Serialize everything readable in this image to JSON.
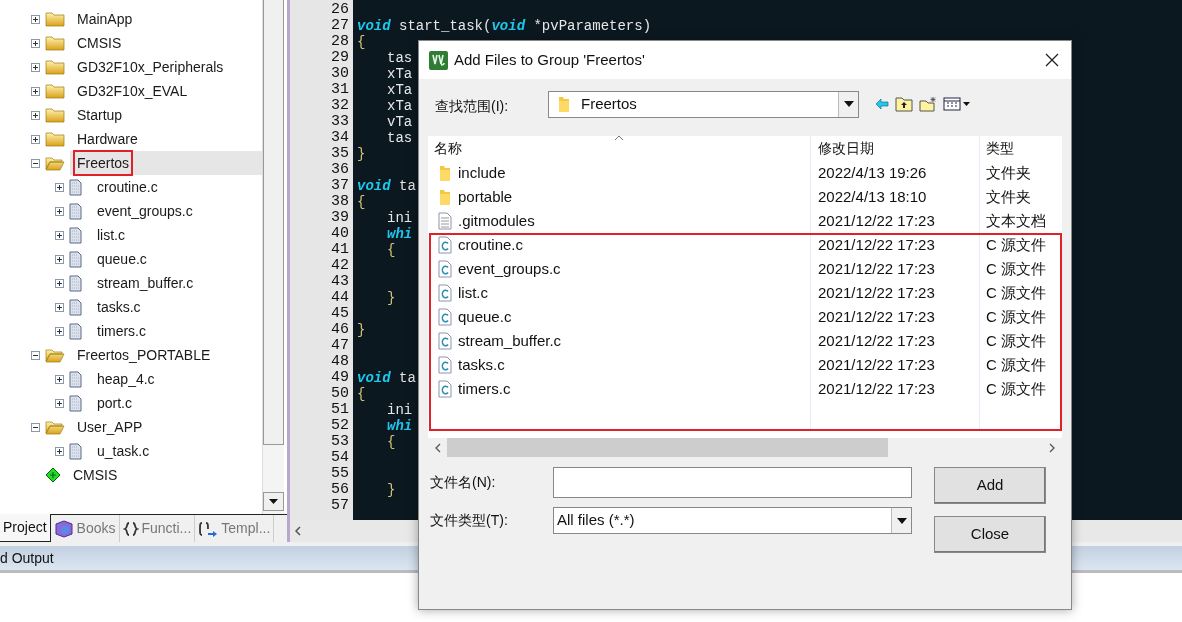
{
  "project_tree": [
    {
      "label": "MainApp",
      "kind": "group",
      "expanded": false,
      "selected": false,
      "highlighted": false
    },
    {
      "label": "CMSIS",
      "kind": "group",
      "expanded": false,
      "selected": false,
      "highlighted": false
    },
    {
      "label": "GD32F10x_Peripherals",
      "kind": "group",
      "expanded": false,
      "selected": false,
      "highlighted": false
    },
    {
      "label": "GD32F10x_EVAL",
      "kind": "group",
      "expanded": false,
      "selected": false,
      "highlighted": false
    },
    {
      "label": "Startup",
      "kind": "group",
      "expanded": false,
      "selected": false,
      "highlighted": false
    },
    {
      "label": "Hardware",
      "kind": "group",
      "expanded": false,
      "selected": false,
      "highlighted": false
    },
    {
      "label": "Freertos",
      "kind": "group",
      "expanded": true,
      "selected": true,
      "highlighted": true,
      "children": [
        {
          "label": "croutine.c",
          "kind": "file"
        },
        {
          "label": "event_groups.c",
          "kind": "file"
        },
        {
          "label": "list.c",
          "kind": "file"
        },
        {
          "label": "queue.c",
          "kind": "file"
        },
        {
          "label": "stream_buffer.c",
          "kind": "file"
        },
        {
          "label": "tasks.c",
          "kind": "file"
        },
        {
          "label": "timers.c",
          "kind": "file"
        }
      ]
    },
    {
      "label": "Freertos_PORTABLE",
      "kind": "group",
      "expanded": true,
      "selected": false,
      "highlighted": false,
      "children": [
        {
          "label": "heap_4.c",
          "kind": "file"
        },
        {
          "label": "port.c",
          "kind": "file"
        }
      ]
    },
    {
      "label": "User_APP",
      "kind": "group",
      "expanded": true,
      "selected": false,
      "highlighted": false,
      "children": [
        {
          "label": "u_task.c",
          "kind": "file"
        }
      ]
    },
    {
      "label": "CMSIS",
      "kind": "component",
      "selected": false,
      "highlighted": false
    }
  ],
  "panel_tabs": [
    {
      "label": "Project",
      "kind": "project",
      "selected": true
    },
    {
      "label": "Books",
      "kind": "books",
      "selected": false
    },
    {
      "label": "Functi...",
      "kind": "functions",
      "selected": false
    },
    {
      "label": "Templ...",
      "kind": "templates",
      "selected": false
    }
  ],
  "code_lines": [
    {
      "number": "26"
    },
    {
      "number": "27",
      "indented": false,
      "segments": [
        {
          "text": "void",
          "kind": "keyword"
        },
        {
          "text": " start_task(",
          "kind": "plain"
        },
        {
          "text": "void",
          "kind": "keyword"
        },
        {
          "text": " *pvParameters)",
          "kind": "plain"
        }
      ]
    },
    {
      "number": "28",
      "indented": false,
      "segments": [
        {
          "text": "{",
          "kind": "brace"
        }
      ]
    },
    {
      "number": "29",
      "indented": true,
      "segments": [
        {
          "text": "tas",
          "kind": "plain"
        }
      ]
    },
    {
      "number": "30",
      "indented": true,
      "segments": [
        {
          "text": "xTa",
          "kind": "plain"
        }
      ]
    },
    {
      "number": "31",
      "indented": true,
      "segments": [
        {
          "text": "xTa",
          "kind": "plain"
        }
      ]
    },
    {
      "number": "32",
      "indented": true,
      "segments": [
        {
          "text": "xTa",
          "kind": "plain"
        }
      ]
    },
    {
      "number": "33",
      "indented": true,
      "segments": [
        {
          "text": "vTa",
          "kind": "plain"
        }
      ]
    },
    {
      "number": "34",
      "indented": true,
      "segments": [
        {
          "text": "tas",
          "kind": "plain"
        }
      ]
    },
    {
      "number": "35",
      "indented": false,
      "segments": [
        {
          "text": "}",
          "kind": "brace"
        }
      ]
    },
    {
      "number": "36"
    },
    {
      "number": "37",
      "indented": false,
      "segments": [
        {
          "text": "void",
          "kind": "keyword"
        },
        {
          "text": " ta",
          "kind": "plain"
        }
      ]
    },
    {
      "number": "38",
      "indented": false,
      "segments": [
        {
          "text": "{",
          "kind": "brace"
        }
      ]
    },
    {
      "number": "39",
      "indented": true,
      "segments": [
        {
          "text": "ini",
          "kind": "plain"
        }
      ]
    },
    {
      "number": "40",
      "indented": true,
      "segments": [
        {
          "text": "whi",
          "kind": "keyword"
        }
      ]
    },
    {
      "number": "41",
      "indented": true,
      "segments": [
        {
          "text": "{",
          "kind": "brace"
        }
      ]
    },
    {
      "number": "42"
    },
    {
      "number": "43"
    },
    {
      "number": "44",
      "indented": true,
      "segments": [
        {
          "text": "}",
          "kind": "brace"
        }
      ]
    },
    {
      "number": "45"
    },
    {
      "number": "46",
      "indented": false,
      "segments": [
        {
          "text": "}",
          "kind": "brace"
        }
      ]
    },
    {
      "number": "47"
    },
    {
      "number": "48"
    },
    {
      "number": "49",
      "indented": false,
      "segments": [
        {
          "text": "void",
          "kind": "keyword"
        },
        {
          "text": " ta",
          "kind": "plain"
        }
      ]
    },
    {
      "number": "50",
      "indented": false,
      "segments": [
        {
          "text": "{",
          "kind": "brace"
        }
      ]
    },
    {
      "number": "51",
      "indented": true,
      "segments": [
        {
          "text": "ini",
          "kind": "plain"
        }
      ]
    },
    {
      "number": "52",
      "indented": true,
      "segments": [
        {
          "text": "whi",
          "kind": "keyword"
        }
      ]
    },
    {
      "number": "53",
      "indented": true,
      "segments": [
        {
          "text": "{",
          "kind": "brace"
        }
      ]
    },
    {
      "number": "54"
    },
    {
      "number": "55"
    },
    {
      "number": "56",
      "indented": true,
      "segments": [
        {
          "text": "}",
          "kind": "brace"
        }
      ]
    },
    {
      "number": "57"
    }
  ],
  "output_bar": {
    "title": "d Output"
  },
  "dialog": {
    "title": "Add Files to Group 'Freertos'",
    "look_in": {
      "label": "查找范围(I):",
      "value": "Freertos"
    },
    "columns": [
      "名称",
      "修改日期",
      "类型"
    ],
    "files": [
      {
        "name": "include",
        "modified": "2022/4/13 19:26",
        "type": "文件夹",
        "kind": "folder",
        "highlighted": false
      },
      {
        "name": "portable",
        "modified": "2022/4/13 18:10",
        "type": "文件夹",
        "kind": "folder",
        "highlighted": false
      },
      {
        "name": ".gitmodules",
        "modified": "2021/12/22 17:23",
        "type": "文本文档",
        "kind": "text",
        "highlighted": false
      },
      {
        "name": "croutine.c",
        "modified": "2021/12/22 17:23",
        "type": "C 源文件",
        "kind": "c",
        "highlighted": true
      },
      {
        "name": "event_groups.c",
        "modified": "2021/12/22 17:23",
        "type": "C 源文件",
        "kind": "c",
        "highlighted": true
      },
      {
        "name": "list.c",
        "modified": "2021/12/22 17:23",
        "type": "C 源文件",
        "kind": "c",
        "highlighted": true
      },
      {
        "name": "queue.c",
        "modified": "2021/12/22 17:23",
        "type": "C 源文件",
        "kind": "c",
        "highlighted": true
      },
      {
        "name": "stream_buffer.c",
        "modified": "2021/12/22 17:23",
        "type": "C 源文件",
        "kind": "c",
        "highlighted": true
      },
      {
        "name": "tasks.c",
        "modified": "2021/12/22 17:23",
        "type": "C 源文件",
        "kind": "c",
        "highlighted": true
      },
      {
        "name": "timers.c",
        "modified": "2021/12/22 17:23",
        "type": "C 源文件",
        "kind": "c",
        "highlighted": true
      }
    ],
    "file_name": {
      "label": "文件名(N):"
    },
    "file_type": {
      "label": "文件类型(T):",
      "value": "All files (*.*)"
    },
    "buttons": [
      "Add",
      "Close"
    ]
  }
}
